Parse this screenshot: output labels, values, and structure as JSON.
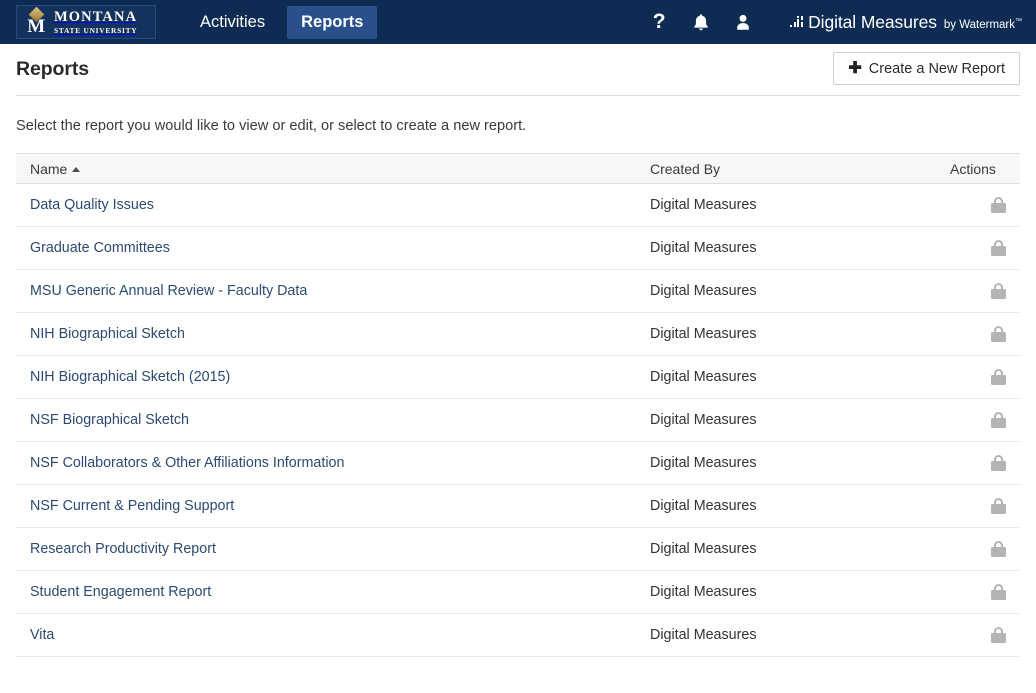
{
  "navbar": {
    "logo": {
      "icon": "msu-bobcat-m-logo",
      "line1": "MONTANA",
      "line2": "STATE UNIVERSITY"
    },
    "links": [
      {
        "label": "Activities",
        "active": false
      },
      {
        "label": "Reports",
        "active": true
      }
    ],
    "icons": [
      {
        "name": "help-icon",
        "glyph": "?"
      },
      {
        "name": "notifications-bell-icon",
        "glyph": "bell"
      },
      {
        "name": "user-account-icon",
        "glyph": "person"
      }
    ],
    "product": {
      "mark": "digital-measures-dots-icon",
      "name": "Digital Measures",
      "by": "by Watermark",
      "tm": "™"
    },
    "background_color": "#0e2b54",
    "active_tab_color": "#29508a"
  },
  "page": {
    "title": "Reports",
    "create_button": {
      "label": "Create a New Report",
      "icon": "plus-icon"
    },
    "instruction": "Select the report you would like to view or edit, or select to create a new report."
  },
  "table": {
    "columns": [
      "Name",
      "Created By",
      "Actions"
    ],
    "sort": {
      "column": "Name",
      "direction": "ascending",
      "indicator": "▲"
    },
    "rows": [
      {
        "name": "Data Quality Issues",
        "created_by": "Digital Measures",
        "action_icon": "lock-icon"
      },
      {
        "name": "Graduate Committees",
        "created_by": "Digital Measures",
        "action_icon": "lock-icon"
      },
      {
        "name": "MSU Generic Annual Review - Faculty Data",
        "created_by": "Digital Measures",
        "action_icon": "lock-icon"
      },
      {
        "name": "NIH Biographical Sketch",
        "created_by": "Digital Measures",
        "action_icon": "lock-icon"
      },
      {
        "name": "NIH Biographical Sketch (2015)",
        "created_by": "Digital Measures",
        "action_icon": "lock-icon"
      },
      {
        "name": "NSF Biographical Sketch",
        "created_by": "Digital Measures",
        "action_icon": "lock-icon"
      },
      {
        "name": "NSF Collaborators & Other Affiliations Information",
        "created_by": "Digital Measures",
        "action_icon": "lock-icon"
      },
      {
        "name": "NSF Current & Pending Support",
        "created_by": "Digital Measures",
        "action_icon": "lock-icon"
      },
      {
        "name": "Research Productivity Report",
        "created_by": "Digital Measures",
        "action_icon": "lock-icon"
      },
      {
        "name": "Student Engagement Report",
        "created_by": "Digital Measures",
        "action_icon": "lock-icon"
      },
      {
        "name": "Vita",
        "created_by": "Digital Measures",
        "action_icon": "lock-icon"
      }
    ]
  },
  "colors": {
    "link": "#2c4a72",
    "lock": "#b4b4b4",
    "header_bg": "#f7f7f7"
  }
}
